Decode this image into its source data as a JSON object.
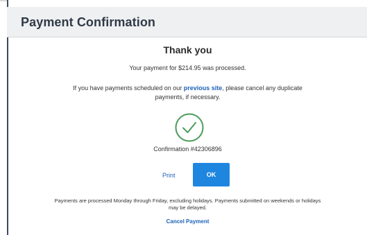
{
  "dialog": {
    "title": "Payment Confirmation"
  },
  "content": {
    "thank_you": "Thank you",
    "processed_text": "Your payment for $214.95 was processed.",
    "notice_before_link": "If you have payments scheduled on our ",
    "notice_link": "previous site",
    "notice_after_link": ", please cancel any duplicate",
    "notice_line2": "payments, if necessary.",
    "confirmation": "Confirmation #42306896"
  },
  "actions": {
    "print_label": "Print",
    "ok_label": "OK",
    "cancel_label": "Cancel Payment"
  },
  "footer": {
    "note_line1": "Payments are processed Monday through Friday, excluding holidays. Payments submitted on weekends or holidays",
    "note_line2": "may be delayed."
  },
  "icons": {
    "success": "check-circle-icon"
  },
  "colors": {
    "accent": "#1f86e0",
    "link": "#1e62b8",
    "success": "#4a9d5b",
    "header_bg": "#eef0f2"
  }
}
